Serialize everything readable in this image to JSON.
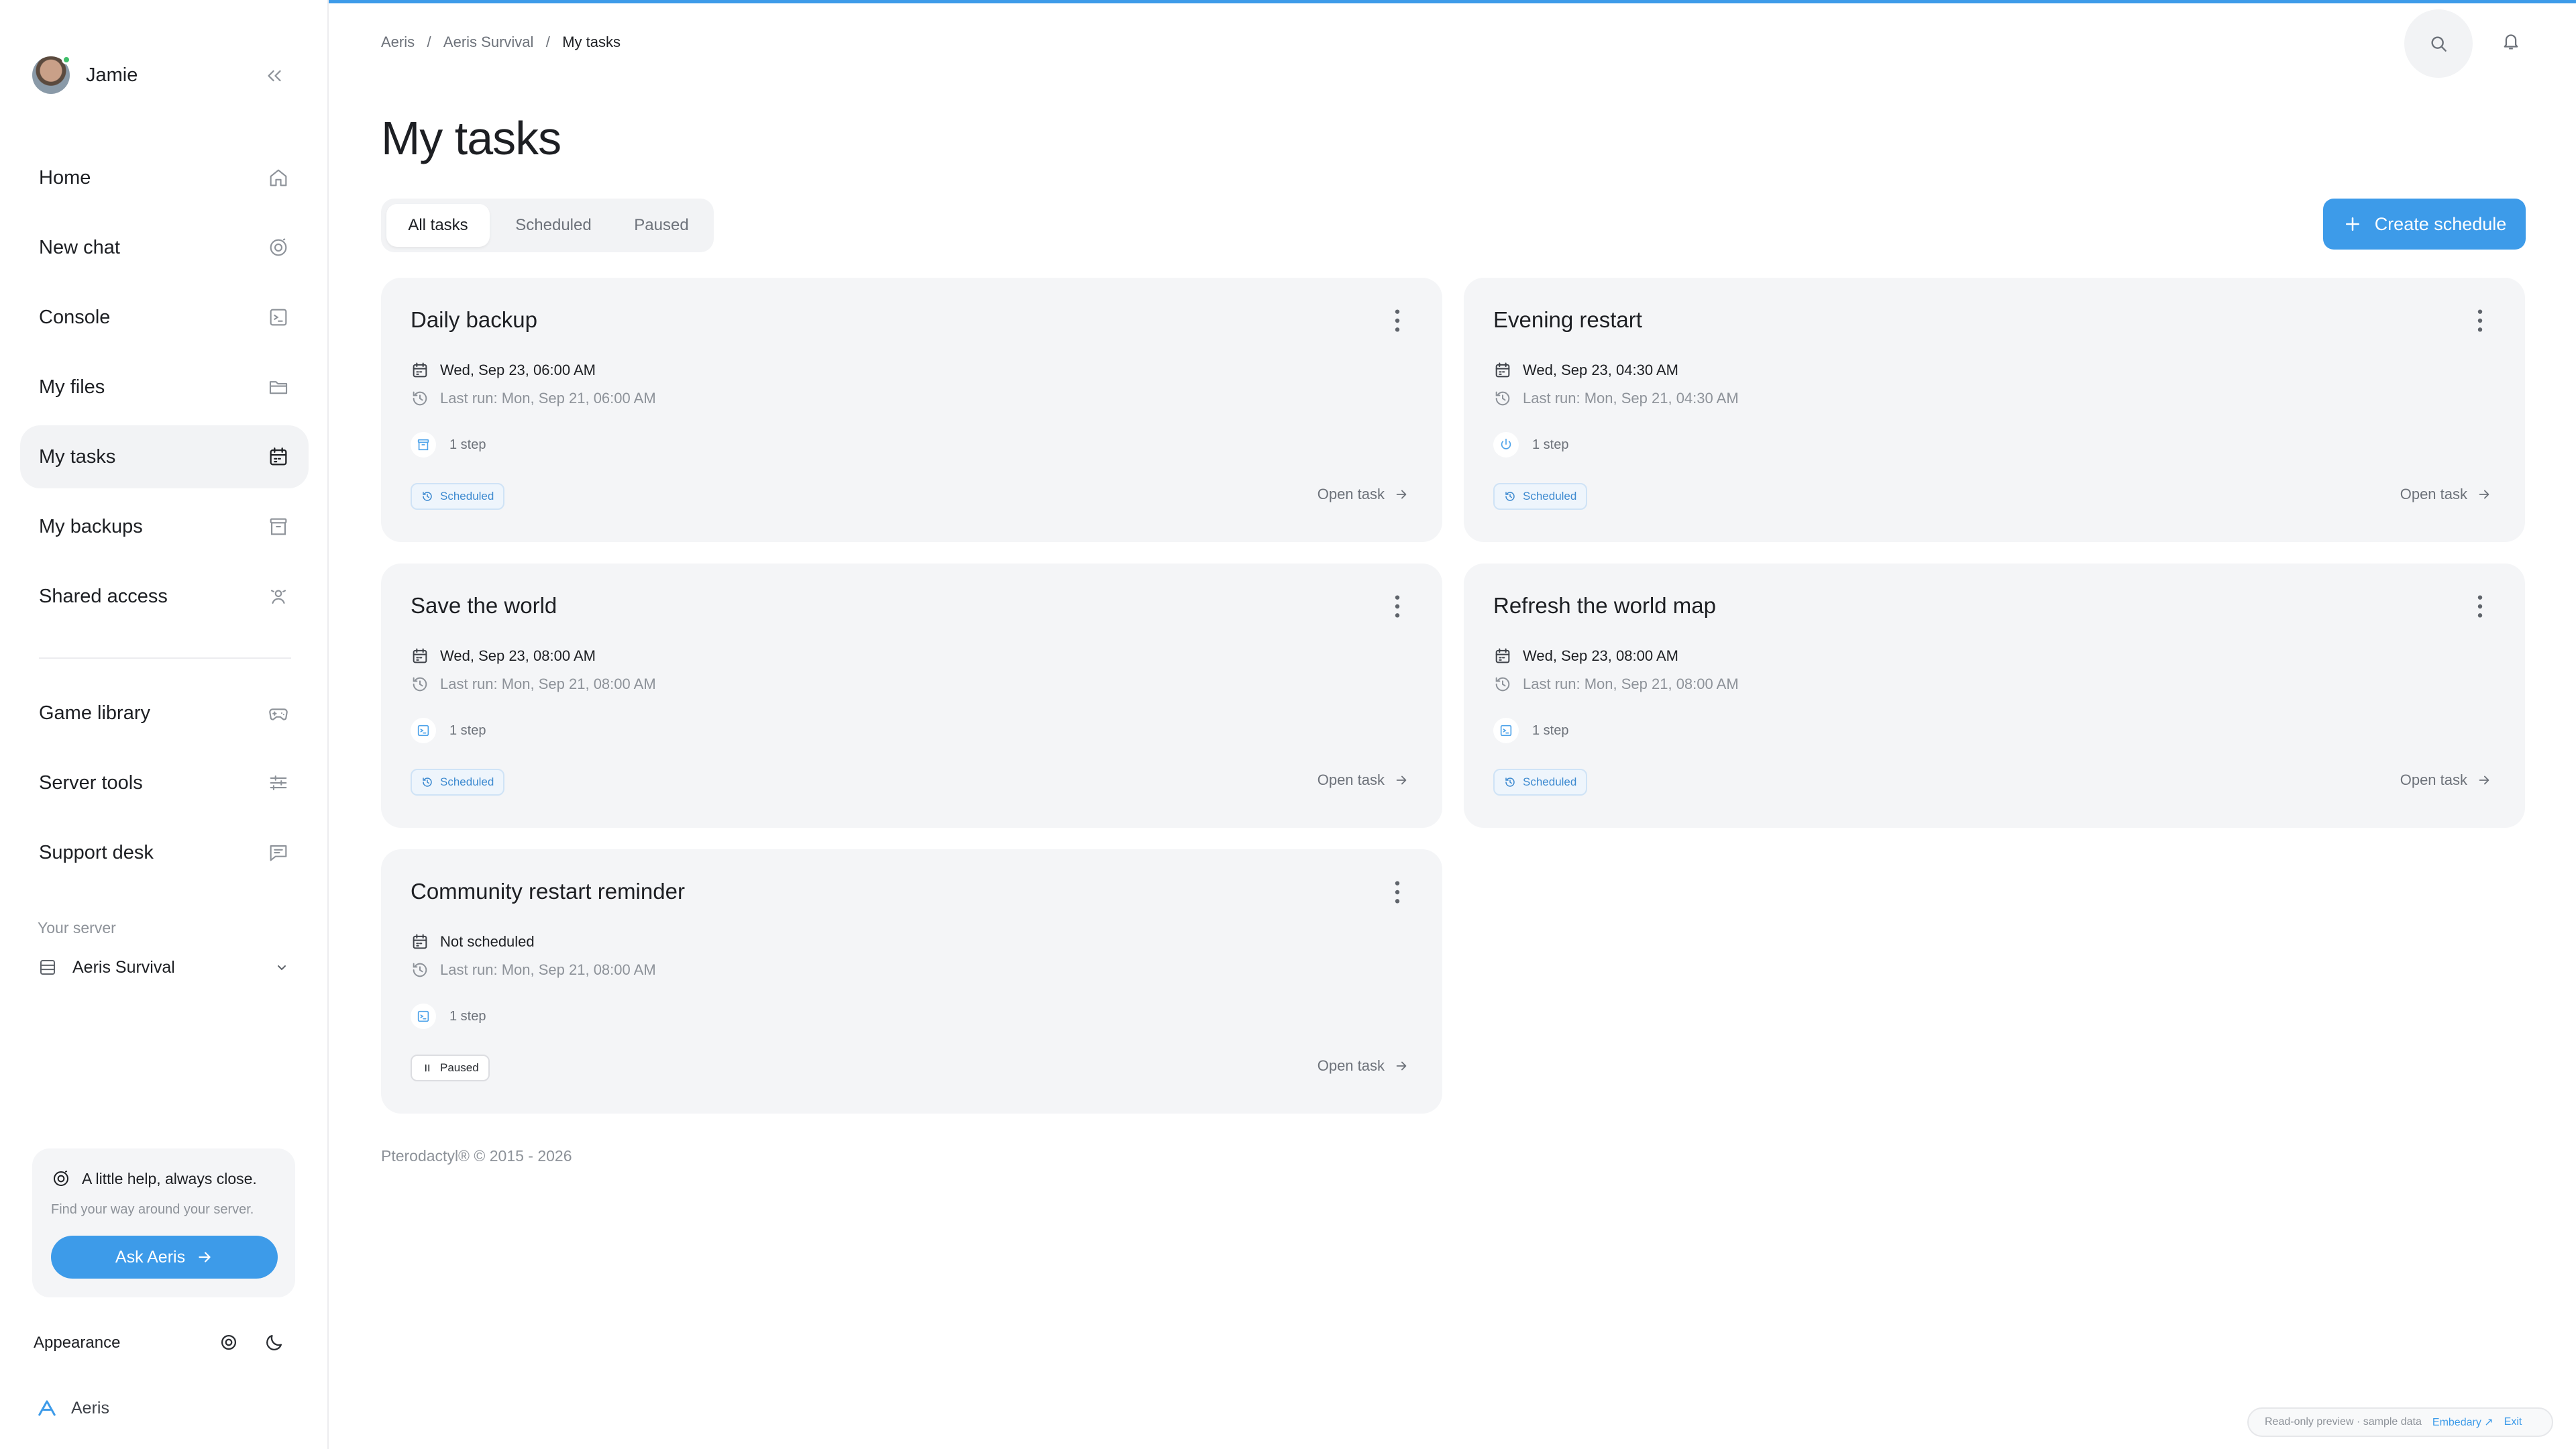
{
  "user": {
    "name": "Jamie"
  },
  "sidebar": {
    "items": [
      {
        "label": "Home",
        "icon": "home-icon"
      },
      {
        "label": "New chat",
        "icon": "chat-spark-icon"
      },
      {
        "label": "Console",
        "icon": "terminal-icon"
      },
      {
        "label": "My files",
        "icon": "folder-icon"
      },
      {
        "label": "My tasks",
        "icon": "calendar-icon",
        "active": true
      },
      {
        "label": "My backups",
        "icon": "archive-icon"
      },
      {
        "label": "Shared access",
        "icon": "users-icon"
      }
    ],
    "items2": [
      {
        "label": "Game library",
        "icon": "gamepad-icon"
      },
      {
        "label": "Server tools",
        "icon": "sliders-icon"
      },
      {
        "label": "Support desk",
        "icon": "message-icon"
      }
    ],
    "server_label": "Your server",
    "server_name": "Aeris Survival",
    "help": {
      "title": "A little help, always close.",
      "subtitle": "Find your way around your server.",
      "button": "Ask Aeris"
    },
    "appearance": "Appearance",
    "brand": "Aeris"
  },
  "breadcrumb": [
    "Aeris",
    "Aeris Survival",
    "My tasks"
  ],
  "page": {
    "title": "My tasks"
  },
  "tabs": [
    "All tasks",
    "Scheduled",
    "Paused"
  ],
  "create_button": "Create schedule",
  "tasks": [
    {
      "title": "Daily backup",
      "next": "Wed, Sep 23, 06:00 AM",
      "last": "Last run: Mon, Sep 21, 06:00 AM",
      "steps": "1 step",
      "step_icon": "archive-icon",
      "status": "Scheduled",
      "open": "Open task"
    },
    {
      "title": "Evening restart",
      "next": "Wed, Sep 23, 04:30 AM",
      "last": "Last run: Mon, Sep 21, 04:30 AM",
      "steps": "1 step",
      "step_icon": "power-icon",
      "status": "Scheduled",
      "open": "Open task"
    },
    {
      "title": "Save the world",
      "next": "Wed, Sep 23, 08:00 AM",
      "last": "Last run: Mon, Sep 21, 08:00 AM",
      "steps": "1 step",
      "step_icon": "terminal-icon",
      "status": "Scheduled",
      "open": "Open task"
    },
    {
      "title": "Refresh the world map",
      "next": "Wed, Sep 23, 08:00 AM",
      "last": "Last run: Mon, Sep 21, 08:00 AM",
      "steps": "1 step",
      "step_icon": "terminal-icon",
      "status": "Scheduled",
      "open": "Open task"
    },
    {
      "title": "Community restart reminder",
      "next": "Not scheduled",
      "last": "Last run: Mon, Sep 21, 08:00 AM",
      "steps": "1 step",
      "step_icon": "terminal-icon",
      "status": "Paused",
      "open": "Open task"
    }
  ],
  "footer": "Pterodactyl® © 2015 - 2026",
  "preview": {
    "text": "Read-only preview · sample data",
    "link": "Embedary ↗",
    "exit": "Exit"
  },
  "colors": {
    "accent": "#3d9be9",
    "card": "#f4f5f7",
    "badge_text": "#3d8ad0"
  }
}
